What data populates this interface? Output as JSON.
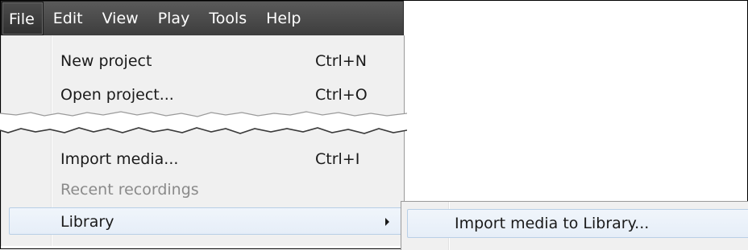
{
  "menubar": {
    "items": [
      {
        "label": "File"
      },
      {
        "label": "Edit"
      },
      {
        "label": "View"
      },
      {
        "label": "Play"
      },
      {
        "label": "Tools"
      },
      {
        "label": "Help"
      }
    ]
  },
  "file_menu": {
    "new_project": {
      "label": "New project",
      "shortcut": "Ctrl+N"
    },
    "open_project": {
      "label": "Open project...",
      "shortcut": "Ctrl+O"
    },
    "import_media": {
      "label": "Import media...",
      "shortcut": "Ctrl+I"
    },
    "recent_recordings": {
      "label": "Recent recordings"
    },
    "library": {
      "label": "Library"
    }
  },
  "library_submenu": {
    "import_to_library": {
      "label": "Import media to Library..."
    }
  },
  "colors": {
    "menubar_bg": "#3d3d3d",
    "menu_bg": "#f0f0f0",
    "highlight_border": "#b8cfe6",
    "disabled_text": "#8a8a8a"
  }
}
